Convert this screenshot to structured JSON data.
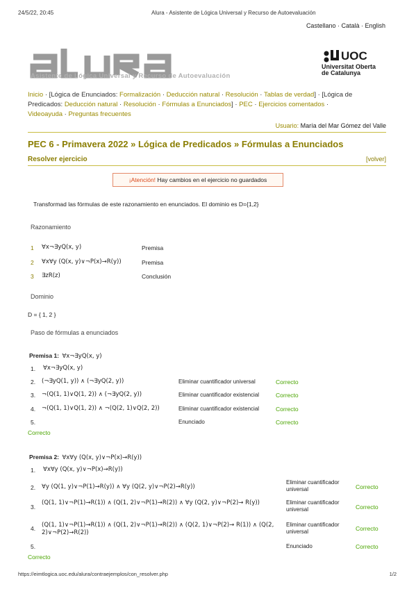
{
  "print_header": {
    "datetime": "24/5/22, 20:45",
    "page_title": "Alura - Asistente de Lógica Universal y Recurso de Autoevaluación"
  },
  "languages": "Castellano · Català · English",
  "logo": {
    "text": "aluRa",
    "subtitle": "Asistente de Lógica Universal y Recurso de Autoevaluación",
    "uoc_name": "UOC",
    "uoc_line1": "Universitat Oberta",
    "uoc_line2": "de Catalunya"
  },
  "nav": {
    "inicio": "Inicio",
    "sep1": " · [Lógica de Enunciados: ",
    "formalizacion": "Formalización",
    "deduccion1": "Deducción natural",
    "resolucion1": "Resolución",
    "tablas": "Tablas de verdad",
    "sep2": "] · [Lógica de",
    "predicados_lbl": "Predicados: ",
    "deduccion2": "Deducción natural",
    "resolucion2": "Resolución",
    "formulas": "Fórmulas a Enunciados",
    "sep3": "] · ",
    "pec": "PEC",
    "ejercicios": "Ejercicios comentados",
    "videoayuda": "Videoayuda",
    "preguntas": "Preguntas frecuentes",
    "dot": " · "
  },
  "user": {
    "label": "Usuario:",
    "name": "María del Mar Gómez del Valle"
  },
  "title": "PEC 6 - Primavera 2022 » Lógica de Predicados » Fórmulas a Enunciados",
  "subtitle": "Resolver ejercicio",
  "volver": "[volver]",
  "warning": {
    "attention": "¡Atención!",
    "message": "Hay cambios en el ejercicio no guardados"
  },
  "instruction": "Transformad las fórmulas de este razonamiento en enunciados. El dominio es D={1,2}",
  "razonamiento": {
    "heading": "Razonamiento",
    "rows": [
      {
        "n": "1",
        "formula": "∀x¬∃yQ(x, y)",
        "type": "Premisa"
      },
      {
        "n": "2",
        "formula": "∀x∀y (Q(x, y)∨¬P(x)→R(y))",
        "type": "Premisa"
      },
      {
        "n": "3",
        "formula": "∃zR(z)",
        "type": "Conclusión"
      }
    ]
  },
  "dominio": {
    "heading": "Dominio",
    "value": "D = { 1, 2 }"
  },
  "paso_heading": "Paso de fórmulas a enunciados",
  "premisa1": {
    "label": "Premisa 1:",
    "formula": "∀x¬∃yQ(x, y)",
    "steps": [
      {
        "n": "1.",
        "formula": "∀x¬∃yQ(x, y)",
        "rule": "",
        "status": ""
      },
      {
        "n": "2.",
        "formula": "(¬∃yQ(1, y)) ∧ (¬∃yQ(2, y))",
        "rule": "Eliminar cuantificador universal",
        "status": "Correcto"
      },
      {
        "n": "3.",
        "formula": "¬(Q(1, 1)∨Q(1, 2)) ∧ (¬∃yQ(2, y))",
        "rule": "Eliminar cuantificador existencial",
        "status": "Correcto"
      },
      {
        "n": "4.",
        "formula": "¬(Q(1, 1)∨Q(1, 2)) ∧ ¬(Q(2, 1)∨Q(2, 2))",
        "rule": "Eliminar cuantificador existencial",
        "status": "Correcto"
      },
      {
        "n": "5.",
        "formula": "",
        "rule": "Enunciado",
        "status": "Correcto"
      }
    ],
    "final_status": "Correcto"
  },
  "premisa2": {
    "label": "Premisa 2:",
    "formula": "∀x∀y (Q(x, y)∨¬P(x)→R(y))",
    "steps": [
      {
        "n": "1.",
        "formula": "∀x∀y (Q(x, y)∨¬P(x)→R(y))",
        "rule": "",
        "status": ""
      },
      {
        "n": "2.",
        "formula": "∀y (Q(1, y)∨¬P(1)→R(y)) ∧ ∀y (Q(2, y)∨¬P(2)→R(y))",
        "rule": "Eliminar cuantificador universal",
        "status": "Correcto"
      },
      {
        "n": "3.",
        "formula": "(Q(1, 1)∨¬P(1)→R(1)) ∧ (Q(1, 2)∨¬P(1)→R(2)) ∧ ∀y (Q(2, y)∨¬P(2)→ R(y))",
        "rule": "Eliminar cuantificador universal",
        "status": "Correcto"
      },
      {
        "n": "4.",
        "formula": "(Q(1, 1)∨¬P(1)→R(1)) ∧ (Q(1, 2)∨¬P(1)→R(2)) ∧ (Q(2, 1)∨¬P(2)→ R(1)) ∧ (Q(2, 2)∨¬P(2)→R(2))",
        "rule": "Eliminar cuantificador universal",
        "status": "Correcto"
      },
      {
        "n": "5.",
        "formula": "",
        "rule": "Enunciado",
        "status": "Correcto"
      }
    ],
    "final_status": "Correcto"
  },
  "footer": {
    "url": "https://eimtlogica.uoc.edu/alura/contraejemplos/con_resolver.php",
    "page": "1/2"
  },
  "colors": {
    "accent": "#8a7d00",
    "link": "#9a8a00",
    "ok": "#4aa400",
    "warning": "#d9481a"
  }
}
